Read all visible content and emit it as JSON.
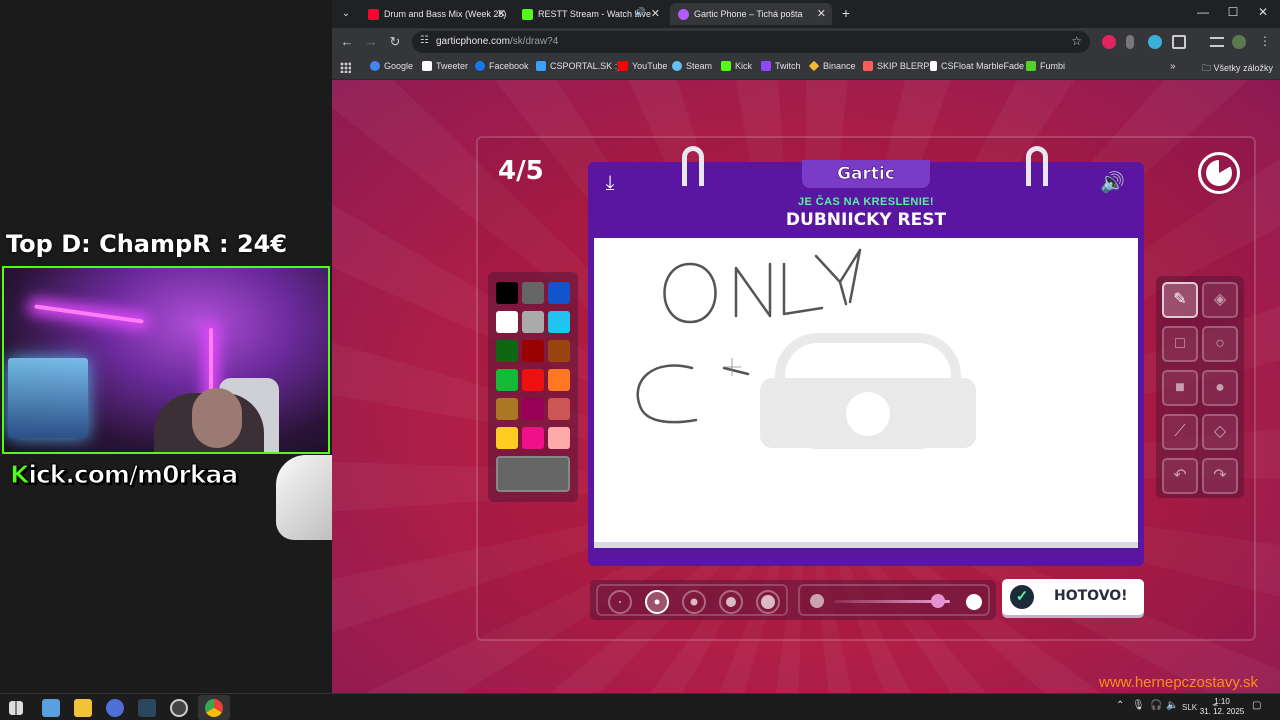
{
  "overlay": {
    "donation": "Top D: ChampR : 24€",
    "kick_prefix": "K",
    "kick_rest": "ick.com/m0rkaa"
  },
  "browser": {
    "tabs": [
      {
        "label": "Drum and Bass Mix (Week 25)",
        "favicon_color": "#ff0033"
      },
      {
        "label": "RESTT Stream - Watch Live",
        "favicon_color": "#53fc18"
      },
      {
        "label": "Gartic Phone – Tichá pošta",
        "favicon_color": "#b05cff"
      }
    ],
    "url_host": "garticphone.com",
    "url_path": "/sk/draw?4",
    "bookmarks": [
      "Google",
      "Tweeter",
      "Facebook",
      "CSPORTAL.SK :)",
      "YouTube",
      "Steam",
      "Kick",
      "Twitch",
      "Binance",
      "SKIP BLERP",
      "CSFloat MarbleFade",
      "Fumbi"
    ],
    "bookmark_colors": [
      "#4285f4",
      "#ffffff",
      "#1877f2",
      "#3ba0ff",
      "#ff0000",
      "#66c0f4",
      "#53fc18",
      "#9146ff",
      "#f3ba2f",
      "#ff5c5c",
      "#ffffff",
      "#53d32a"
    ],
    "bookmarks_folder": "Všetky záložky"
  },
  "game": {
    "round": "4/5",
    "brand": "Gartic",
    "prompt_title": "JE ČAS NA KRESLENIE!",
    "prompt_text": "DUBNIICKY REST",
    "done_label": "HOTOVO!",
    "palette": [
      "#000000",
      "#666666",
      "#1155cc",
      "#ffffff",
      "#aaaaaa",
      "#22c3ee",
      "#116611",
      "#990000",
      "#994411",
      "#11bb33",
      "#ee1111",
      "#ff7722",
      "#aa7722",
      "#990055",
      "#cc5555",
      "#ffcc22",
      "#ee1188",
      "#ffaaaa"
    ],
    "selected_color": "#666666",
    "brush_opacity": 0.9
  },
  "watermark": "www.hernepczostavy.sk",
  "taskbar": {
    "language": "SLK",
    "time": "1:10",
    "date": "31. 12. 2025"
  }
}
